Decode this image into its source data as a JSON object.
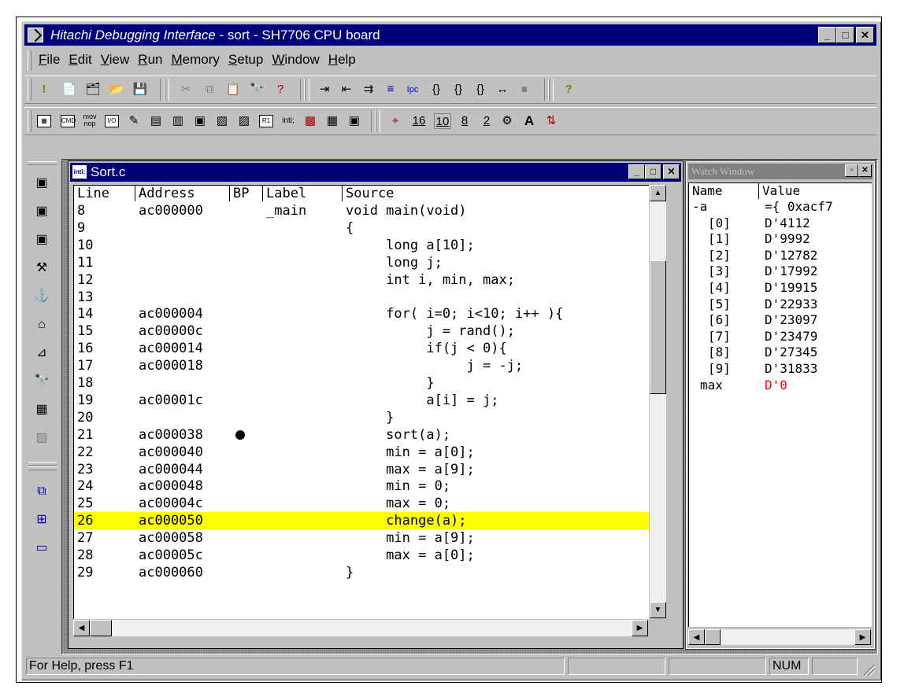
{
  "window": {
    "title_italic": "Hitachi Debugging Interface",
    "title_rest": " - sort - SH7706 CPU board"
  },
  "menu": [
    {
      "key": "F",
      "rest": "ile"
    },
    {
      "key": "E",
      "rest": "dit"
    },
    {
      "key": "V",
      "rest": "iew"
    },
    {
      "key": "R",
      "rest": "un"
    },
    {
      "key": "M",
      "rest": "emory"
    },
    {
      "key": "S",
      "rest": "etup"
    },
    {
      "key": "W",
      "rest": "indow"
    },
    {
      "key": "H",
      "rest": "elp"
    }
  ],
  "toolbar2_text": {
    "mov": "mov",
    "nop": "nop",
    "io": "I/O",
    "cmd": "CMD",
    "r1": "R1",
    "radix16": "16",
    "radix10": "10",
    "radix8": "8",
    "radix2": "2",
    "font_a": "A"
  },
  "source_window": {
    "title": "Sort.c",
    "icon_text": "inti;",
    "columns": [
      "Line",
      "Address",
      "BP",
      "Label",
      "Source"
    ],
    "rows": [
      {
        "line": "8",
        "address": "ac000000",
        "bp": false,
        "label": "_main",
        "source": "void main(void)"
      },
      {
        "line": "9",
        "address": "",
        "bp": false,
        "label": "",
        "source": "{"
      },
      {
        "line": "10",
        "address": "",
        "bp": false,
        "label": "",
        "source": "     long a[10];"
      },
      {
        "line": "11",
        "address": "",
        "bp": false,
        "label": "",
        "source": "     long j;"
      },
      {
        "line": "12",
        "address": "",
        "bp": false,
        "label": "",
        "source": "     int i, min, max;"
      },
      {
        "line": "13",
        "address": "",
        "bp": false,
        "label": "",
        "source": ""
      },
      {
        "line": "14",
        "address": "ac000004",
        "bp": false,
        "label": "",
        "source": "     for( i=0; i<10; i++ ){"
      },
      {
        "line": "15",
        "address": "ac00000c",
        "bp": false,
        "label": "",
        "source": "          j = rand();"
      },
      {
        "line": "16",
        "address": "ac000014",
        "bp": false,
        "label": "",
        "source": "          if(j < 0){"
      },
      {
        "line": "17",
        "address": "ac000018",
        "bp": false,
        "label": "",
        "source": "               j = -j;"
      },
      {
        "line": "18",
        "address": "",
        "bp": false,
        "label": "",
        "source": "          }"
      },
      {
        "line": "19",
        "address": "ac00001c",
        "bp": false,
        "label": "",
        "source": "          a[i] = j;"
      },
      {
        "line": "20",
        "address": "",
        "bp": false,
        "label": "",
        "source": "     }"
      },
      {
        "line": "21",
        "address": "ac000038",
        "bp": true,
        "label": "",
        "source": "     sort(a);"
      },
      {
        "line": "22",
        "address": "ac000040",
        "bp": false,
        "label": "",
        "source": "     min = a[0];"
      },
      {
        "line": "23",
        "address": "ac000044",
        "bp": false,
        "label": "",
        "source": "     max = a[9];"
      },
      {
        "line": "24",
        "address": "ac000048",
        "bp": false,
        "label": "",
        "source": "     min = 0;"
      },
      {
        "line": "25",
        "address": "ac00004c",
        "bp": false,
        "label": "",
        "source": "     max = 0;"
      },
      {
        "line": "26",
        "address": "ac000050",
        "bp": false,
        "label": "",
        "source": "     change(a);",
        "highlight": true
      },
      {
        "line": "27",
        "address": "ac000058",
        "bp": false,
        "label": "",
        "source": "     min = a[9];"
      },
      {
        "line": "28",
        "address": "ac00005c",
        "bp": false,
        "label": "",
        "source": "     max = a[0];"
      },
      {
        "line": "29",
        "address": "ac000060",
        "bp": false,
        "label": "",
        "source": "}"
      }
    ]
  },
  "watch_window": {
    "title": "Watch Window",
    "columns": [
      "Name",
      "Value"
    ],
    "rows": [
      {
        "name": "-a",
        "value": "={ 0xacf7",
        "indent": 0
      },
      {
        "name": "[0]",
        "value": "D'4112",
        "indent": 2
      },
      {
        "name": "[1]",
        "value": "D'9992",
        "indent": 2
      },
      {
        "name": "[2]",
        "value": "D'12782",
        "indent": 2
      },
      {
        "name": "[3]",
        "value": "D'17992",
        "indent": 2
      },
      {
        "name": "[4]",
        "value": "D'19915",
        "indent": 2
      },
      {
        "name": "[5]",
        "value": "D'22933",
        "indent": 2
      },
      {
        "name": "[6]",
        "value": "D'23097",
        "indent": 2
      },
      {
        "name": "[7]",
        "value": "D'23479",
        "indent": 2
      },
      {
        "name": "[8]",
        "value": "D'27345",
        "indent": 2
      },
      {
        "name": "[9]",
        "value": "D'31833",
        "indent": 2
      },
      {
        "name": "max",
        "value": "D'0",
        "indent": 1,
        "changed": true
      }
    ]
  },
  "status": {
    "help": "For Help, press F1",
    "num": "NUM"
  },
  "colors": {
    "titlebar": "#00007b",
    "highlight_line": "#ffff00",
    "changed_value": "#ff0000",
    "face": "#c0c0c0"
  }
}
